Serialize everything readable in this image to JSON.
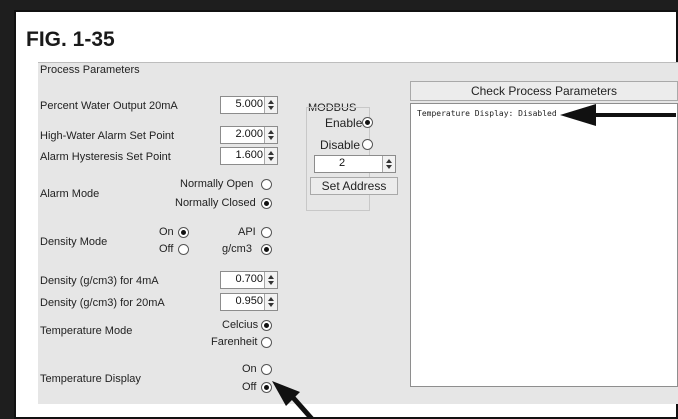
{
  "figure": {
    "title": "FIG. 1-35"
  },
  "panel": {
    "title": "Process Parameters"
  },
  "fields": {
    "water_output_label": "Percent Water Output 20mA",
    "water_output_value": "5.000",
    "high_water_label": "High-Water Alarm Set Point",
    "high_water_value": "2.000",
    "hysteresis_label": "Alarm Hysteresis Set Point",
    "hysteresis_value": "1.600",
    "alarm_mode_label": "Alarm Mode",
    "alarm_mode_opt_open": "Normally Open",
    "alarm_mode_opt_closed": "Normally Closed",
    "density_mode_label": "Density Mode",
    "density_on": "On",
    "density_off": "Off",
    "density_api": "API",
    "density_gcm3": "g/cm3",
    "density_4ma_label": "Density (g/cm3) for 4mA",
    "density_4ma_value": "0.700",
    "density_20ma_label": "Density (g/cm3) for 20mA",
    "density_20ma_value": "0.950",
    "temp_mode_label": "Temperature Mode",
    "temp_celcius": "Celcius",
    "temp_farenheit": "Farenheit",
    "temp_display_label": "Temperature Display",
    "temp_display_on": "On",
    "temp_display_off": "Off"
  },
  "modbus": {
    "title": "MODBUS",
    "enable": "Enable",
    "disable": "Disable",
    "address_value": "2",
    "set_address": "Set Address"
  },
  "check": {
    "button": "Check Process Parameters",
    "log_text": "Temperature Display: Disabled"
  },
  "state": {
    "alarm_mode": "Normally Closed",
    "density_mode": "Off",
    "density_unit": "g/cm3",
    "temp_mode": "Celcius",
    "temp_display": "Off",
    "modbus": "Enable"
  }
}
